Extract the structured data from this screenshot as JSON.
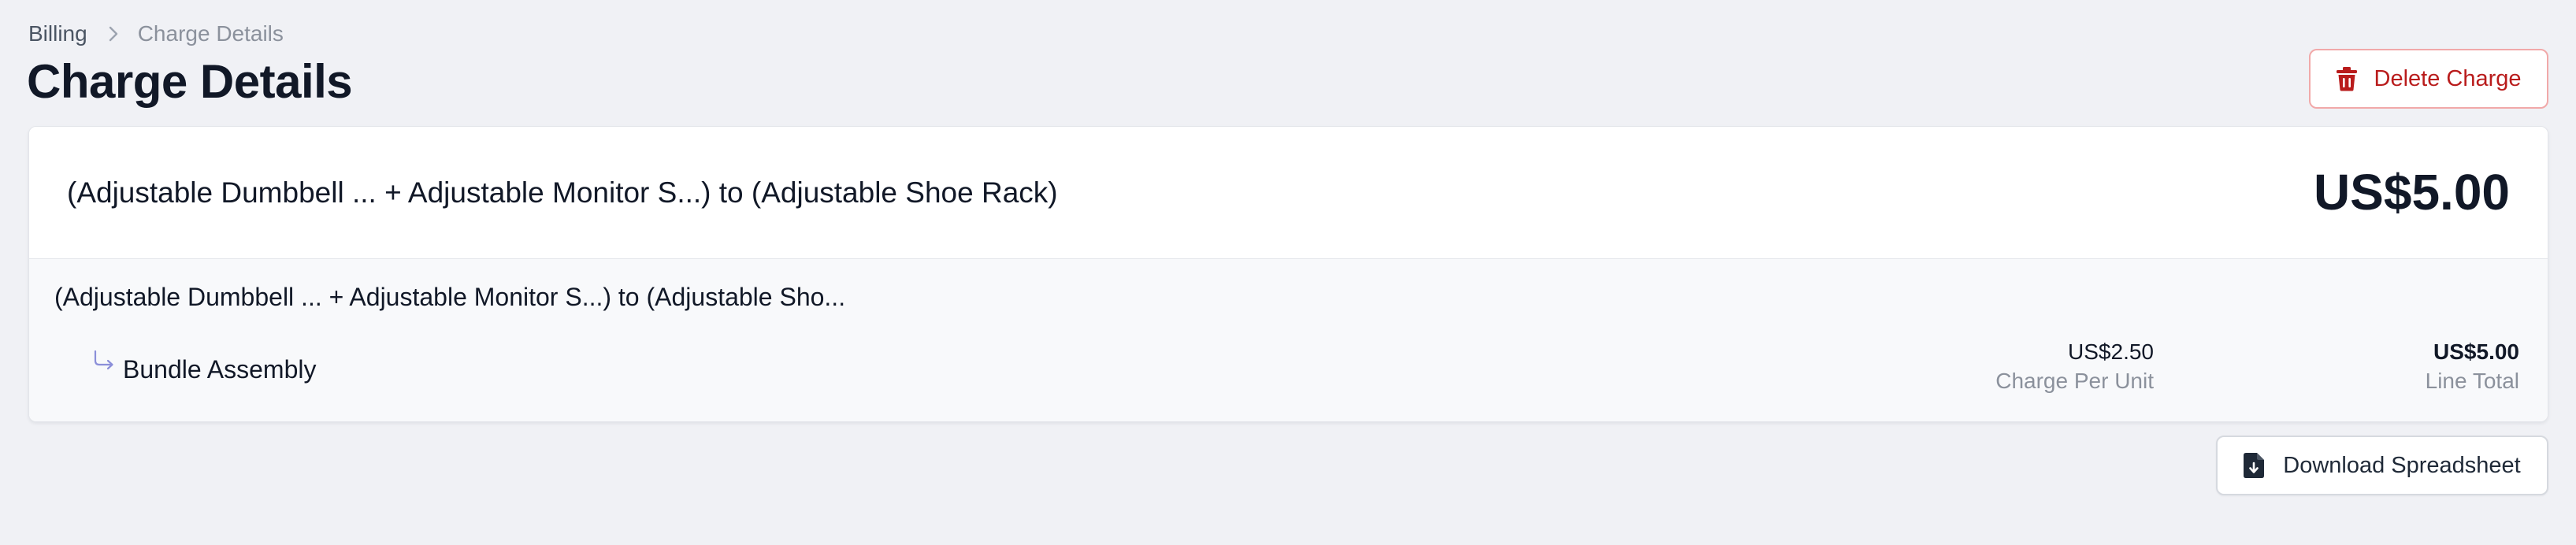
{
  "breadcrumb": {
    "parent": "Billing",
    "current": "Charge Details"
  },
  "page": {
    "title": "Charge Details"
  },
  "actions": {
    "delete_label": "Delete Charge",
    "download_label": "Download Spreadsheet"
  },
  "charge": {
    "title": "(Adjustable Dumbbell ... + Adjustable Monitor S...) to (Adjustable Shoe Rack)",
    "amount": "US$5.00",
    "group_title": "(Adjustable Dumbbell ... + Adjustable Monitor S...) to (Adjustable Sho...",
    "line_items": [
      {
        "name": "Bundle Assembly",
        "charge_per_unit": "US$2.50",
        "charge_per_unit_label": "Charge Per Unit",
        "line_total": "US$5.00",
        "line_total_label": "Line Total"
      }
    ]
  },
  "icons": {
    "breadcrumb_separator": "chevron-right-icon",
    "delete": "trash-icon",
    "download": "document-download-icon",
    "line_item": "arrow-turn-down-right-icon"
  },
  "colors": {
    "background": "#f0f1f5",
    "danger": "#b91c1c",
    "danger_border": "#f1a9a9",
    "accent_arrow": "#8b8fd9",
    "muted_text": "#8b919c"
  }
}
